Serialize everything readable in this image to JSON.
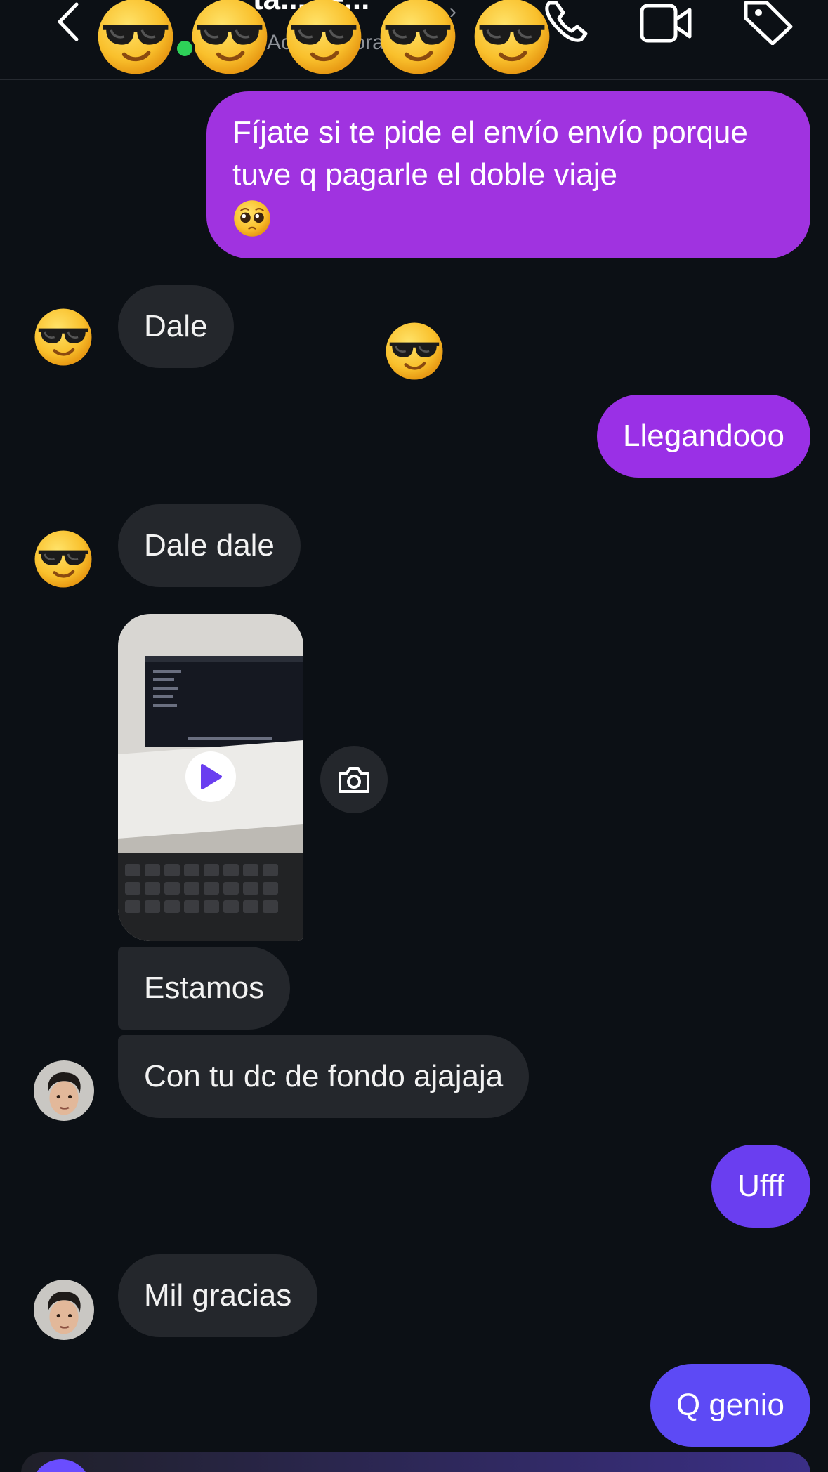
{
  "header": {
    "contact_name": "ta... re...",
    "status": "Activo ahora",
    "icons": [
      "back-chevron-icon",
      "phone-icon",
      "video-camera-icon",
      "tag-icon"
    ]
  },
  "messages": [
    {
      "id": "m1",
      "dir": "out",
      "text": "Fíjate si te pide el envío envío porque tuve q pagarle el doble viaje",
      "emoji": "pleading-face",
      "color": "#a033e0"
    },
    {
      "id": "m2",
      "dir": "in",
      "text": "Dale",
      "avatar": "sunglasses-emoji"
    },
    {
      "id": "m3",
      "dir": "out",
      "text": "Llegandooo",
      "color": "#9a30e6"
    },
    {
      "id": "m4",
      "dir": "in",
      "text": "Dale dale",
      "avatar": "sunglasses-emoji"
    },
    {
      "id": "m5",
      "dir": "in",
      "type": "video",
      "icon": "play-icon"
    },
    {
      "id": "m6",
      "dir": "in",
      "text": "Estamos"
    },
    {
      "id": "m7",
      "dir": "in",
      "text": "Con tu dc de fondo ajajaja",
      "avatar": "person-photo"
    },
    {
      "id": "m8",
      "dir": "out",
      "text": "Ufff",
      "color": "#6a3ef0"
    },
    {
      "id": "m9",
      "dir": "in",
      "text": "Mil gracias",
      "avatar": "person-photo"
    },
    {
      "id": "m10",
      "dir": "out",
      "text": "Q genio",
      "color": "#5d4af5"
    }
  ],
  "colors": {
    "background": "#0c1015",
    "incoming_bubble": "#24272c",
    "online": "#2ed158"
  }
}
